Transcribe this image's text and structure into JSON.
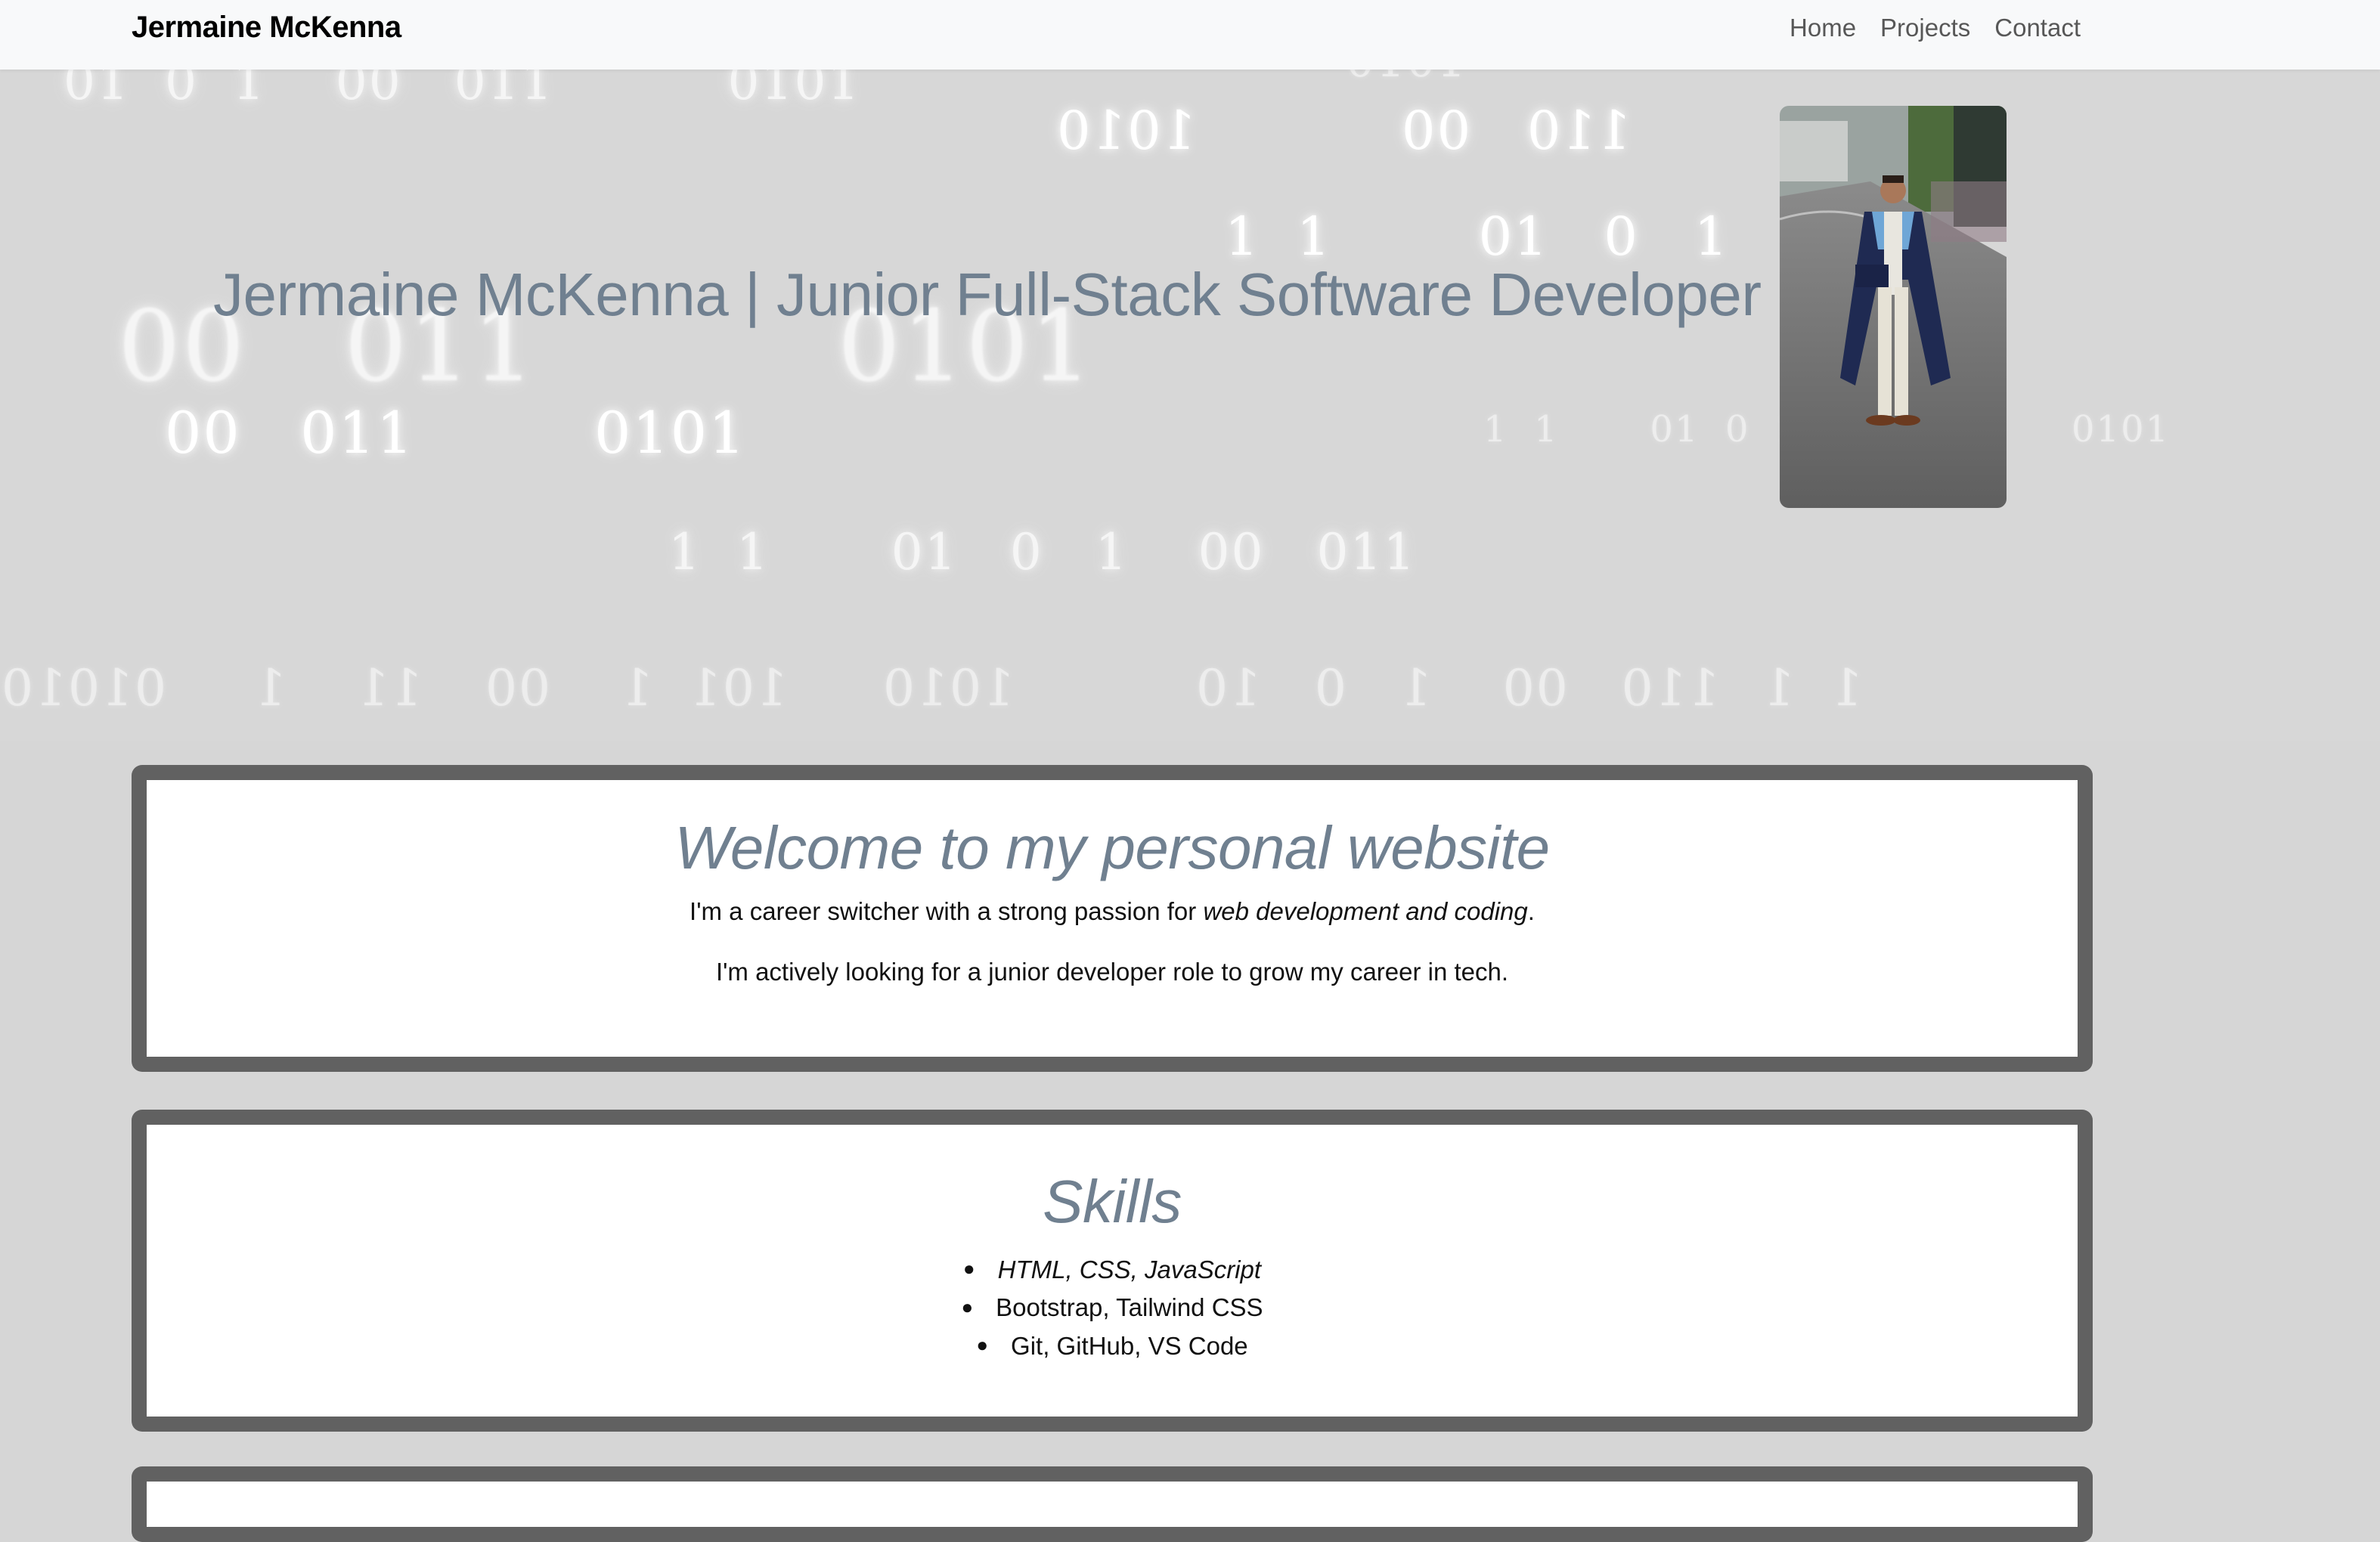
{
  "navbar": {
    "brand": "Jermaine McKenna",
    "links": [
      "Home",
      "Projects",
      "Contact"
    ]
  },
  "hero": {
    "title": "Jermaine McKenna | Junior Full-Stack Software Developer",
    "binary_rows": [
      "01  0  1    00   011          0101",
      "0101",
      "1010",
      "110   00",
      "1  1        01   0   1",
      "00   011",
      "0101",
      "00   011",
      "0101",
      "1  1       01  0  1",
      "0101",
      "1  1       01   0   1    00   011",
      "11    1     01010",
      "101  1    00",
      "1010",
      "110   00    1   0   10",
      "1  1"
    ],
    "photo_alt": "Graduation photo"
  },
  "welcome": {
    "heading": "Welcome to my personal website",
    "intro_prefix": "I'm a career switcher with a strong passion for ",
    "intro_emphasis": "web development and coding",
    "intro_suffix": ".",
    "goal": "I'm actively looking for a junior developer role to grow my career in tech."
  },
  "skills": {
    "heading": "Skills",
    "items": [
      "HTML, CSS, JavaScript",
      "Bootstrap, Tailwind CSS",
      "Git, GitHub, VS Code"
    ]
  },
  "colors": {
    "heading": "#708090",
    "card_border": "#616161",
    "hero_bg": "#d7d7d7",
    "page_bg": "#d6d6d6",
    "navbar_bg": "#f8f9fa"
  }
}
